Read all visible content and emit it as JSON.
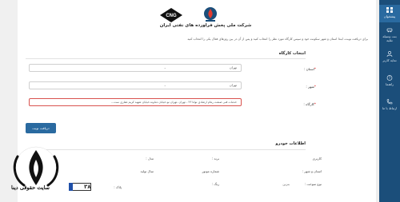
{
  "sidebar": {
    "items": [
      {
        "label": "پیشخوان",
        "icon": "dashboard-icon",
        "active": true
      },
      {
        "label": "بنت وسیله نقلیه",
        "icon": "car-register-icon",
        "active": false
      },
      {
        "label": "نمایه کاربر",
        "icon": "user-profile-icon",
        "active": false
      },
      {
        "label": "راهنما",
        "icon": "help-icon",
        "active": false
      },
      {
        "label": "ارتباط با ما",
        "icon": "contact-icon",
        "active": false
      }
    ]
  },
  "header": {
    "company_name": "شرکت ملی پخش فراورده های نفتی ایران",
    "cng_logo_text": "CNG",
    "intro_text": "برای دریافت نوبت، ابتدا استان و شهر سکونت خود و سپس کارگاه مورد نظر را انتخاب کنید و پس از آن در بین روزهای فعال یکی را انتخاب کنید"
  },
  "workshop_section": {
    "title": "انتخاب کارگاه",
    "province_label": "استان :",
    "province_value": "تهران",
    "city_label": "شهر :",
    "city_value": "تهران",
    "workshop_label": "کارگاه :",
    "workshop_value": "خدمات فنی صنعت رهام ارشادی نوانا ۲۳ - تهران -تهران نو-خیابان دماوند-خیابان شهید کریم غفاری ست...",
    "submit_label": "دریافت نوبت"
  },
  "vehicle_section": {
    "title": "اطلاعات خودرو",
    "rows": [
      {
        "label": "کاربری",
        "value": ""
      },
      {
        "label": "برند :",
        "value": ""
      },
      {
        "label": "مدل :",
        "value": ""
      },
      {
        "label": "استان و شهر :",
        "value": ""
      },
      {
        "label": "شماره موتور",
        "value": ""
      },
      {
        "label": "سال تولید",
        "value": ""
      },
      {
        "label": "نوع سوخت :",
        "value": "بنزین"
      },
      {
        "label": "رنگ :",
        "value": ""
      },
      {
        "label": "پلاک :",
        "value": "۳۸"
      }
    ]
  },
  "watermark": {
    "text": "سایت حقوقی دینا"
  }
}
